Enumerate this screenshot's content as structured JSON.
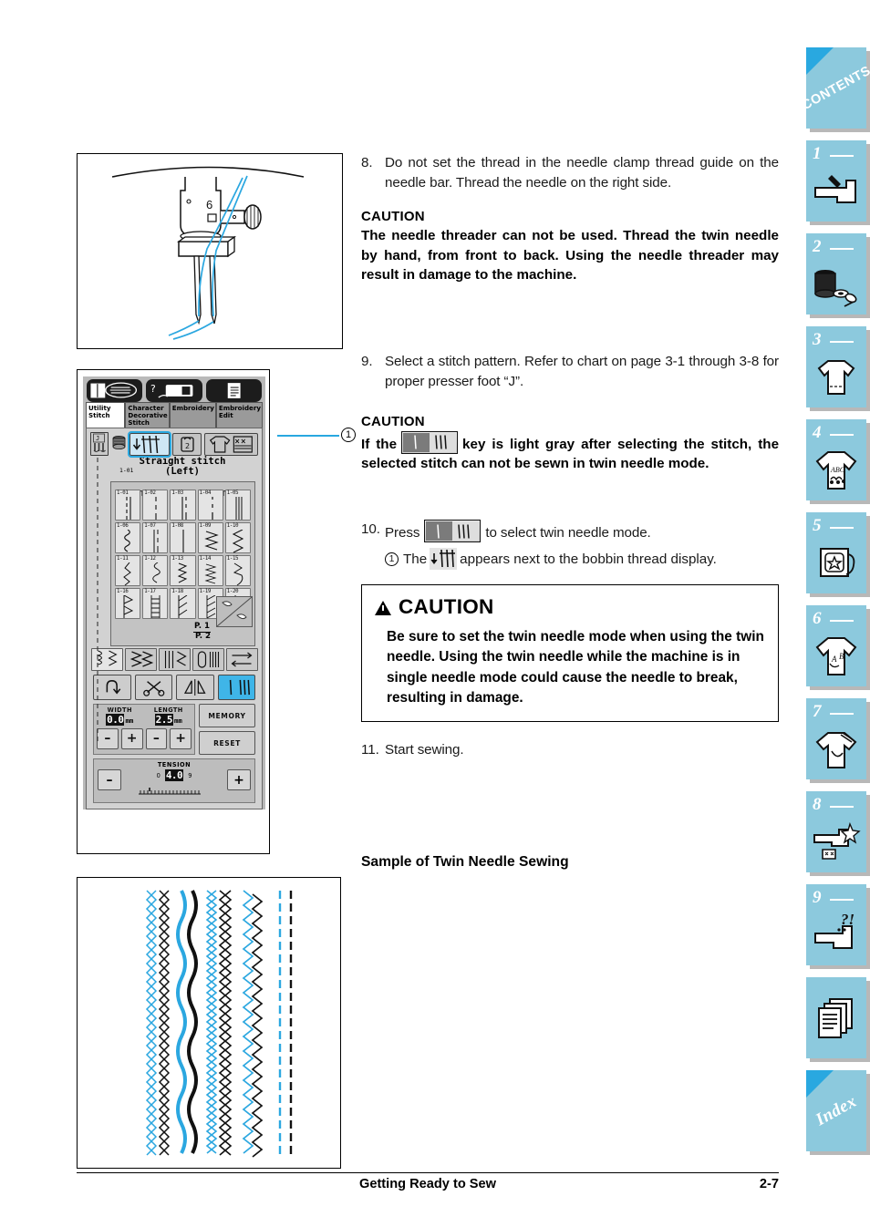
{
  "document": {
    "footer_title": "Getting Ready to Sew",
    "footer_page": "2-7"
  },
  "steps": {
    "step8": {
      "num": "8.",
      "text": "Do not set the thread in the needle clamp thread guide on the needle bar. Thread the needle on the right side."
    },
    "caution8": {
      "head": "CAUTION",
      "text": "The needle threader can not be used. Thread the twin needle by hand, from front to back. Using the needle threader may result in damage to the machine."
    },
    "step9": {
      "num": "9.",
      "text": "Select a stitch pattern. Refer to chart on page 3-1 through 3-8 for proper presser foot “J”."
    },
    "caution9": {
      "head": "CAUTION",
      "text_before": "If the",
      "text_after": "key is light gray after selecting the stitch, the selected stitch can not be sewn in twin needle mode."
    },
    "step10": {
      "num": "10.",
      "text_before": "Press",
      "text_after": "to select twin needle mode.",
      "sub_marker": "1",
      "sub_before": "The",
      "sub_after": "appears next to the bobbin thread display."
    },
    "step11": {
      "num": "11.",
      "text": "Start sewing."
    },
    "sample_heading": "Sample of Twin Needle Sewing"
  },
  "caution_box": {
    "title": "CAUTION",
    "text": "Be sure to set the twin needle mode when using the twin needle. Using the twin needle while the machine is in single needle mode could cause the needle to break, resulting in damage."
  },
  "lcd": {
    "callout_number": "1",
    "top_icons": [
      "manual-book-icon",
      "machine-help-icon",
      "settings-list-icon"
    ],
    "tabs": [
      {
        "label": "Utility\nStitch",
        "active": true
      },
      {
        "label": "Character\nDecorative\nStitch",
        "active": false
      },
      {
        "label": "Embroidery",
        "active": false
      },
      {
        "label": "Embroidery\nEdit",
        "active": false
      }
    ],
    "presser_foot": "J",
    "stitch_number": "1-01",
    "stitch_name_line1": "Straight stitch",
    "stitch_name_line2": "(Left)",
    "stitch_cells": [
      "1-01",
      "1-02",
      "1-03",
      "1-04",
      "1-05",
      "1-06",
      "1-07",
      "1-08",
      "1-09",
      "1-10",
      "1-11",
      "1-12",
      "1-13",
      "1-14",
      "1-15",
      "1-16",
      "1-17",
      "1-18",
      "1-19",
      "1-20"
    ],
    "page_current": "P. 1",
    "page_total": "P. 2",
    "category_buttons": [
      "utility-stitch-cat",
      "decorative-cat",
      "satin-cat",
      "buttonhole-cat",
      "feed-cat"
    ],
    "tool_buttons": [
      "reverse-stitch-button",
      "thread-cutter-button",
      "mirror-image-button",
      "twin-needle-button"
    ],
    "width": {
      "label": "WIDTH",
      "value": "0.0",
      "unit": "mm",
      "minus": "–",
      "plus": "+"
    },
    "length": {
      "label": "LENGTH",
      "value": "2.5",
      "unit": "mm",
      "minus": "–",
      "plus": "+"
    },
    "tension": {
      "label": "TENSION",
      "value": "4.0",
      "min": "0",
      "max": "9",
      "minus": "–",
      "plus": "+"
    },
    "memory_button": "MEMORY",
    "reset_button": "RESET"
  },
  "illustration": {
    "needle_bar_label": "6"
  },
  "sidebar": {
    "contents_label": "CONTENTS",
    "index_label": "Index",
    "tabs": [
      {
        "num": "",
        "label": "CONTENTS",
        "icon": "contents-tab",
        "type": "text-corner"
      },
      {
        "num": "1",
        "label": "",
        "icon": "sewing-machine-icon",
        "type": "num"
      },
      {
        "num": "2",
        "label": "",
        "icon": "thread-spool-icon",
        "type": "num"
      },
      {
        "num": "3",
        "label": "",
        "icon": "shirt-stitch-icon",
        "type": "num"
      },
      {
        "num": "4",
        "label": "",
        "icon": "shirt-abc-icon",
        "type": "num"
      },
      {
        "num": "5",
        "label": "",
        "icon": "embroidery-card-icon",
        "type": "num"
      },
      {
        "num": "6",
        "label": "",
        "icon": "shirt-letters-icon",
        "type": "num"
      },
      {
        "num": "7",
        "label": "",
        "icon": "shirt-needle-icon",
        "type": "num"
      },
      {
        "num": "8",
        "label": "",
        "icon": "machine-clean-icon",
        "type": "num"
      },
      {
        "num": "9",
        "label": "",
        "icon": "machine-question-icon",
        "type": "num"
      },
      {
        "num": "",
        "label": "",
        "icon": "appendix-pages-icon",
        "type": "icon-only"
      },
      {
        "num": "",
        "label": "Index",
        "icon": "index-tab",
        "type": "text-corner"
      }
    ]
  },
  "colors": {
    "tab_blue": "#8cc9dd",
    "accent_blue": "#29a8e0",
    "thread_blue": "#2ba7e0",
    "lcd_gray": "#c3c3c3"
  }
}
